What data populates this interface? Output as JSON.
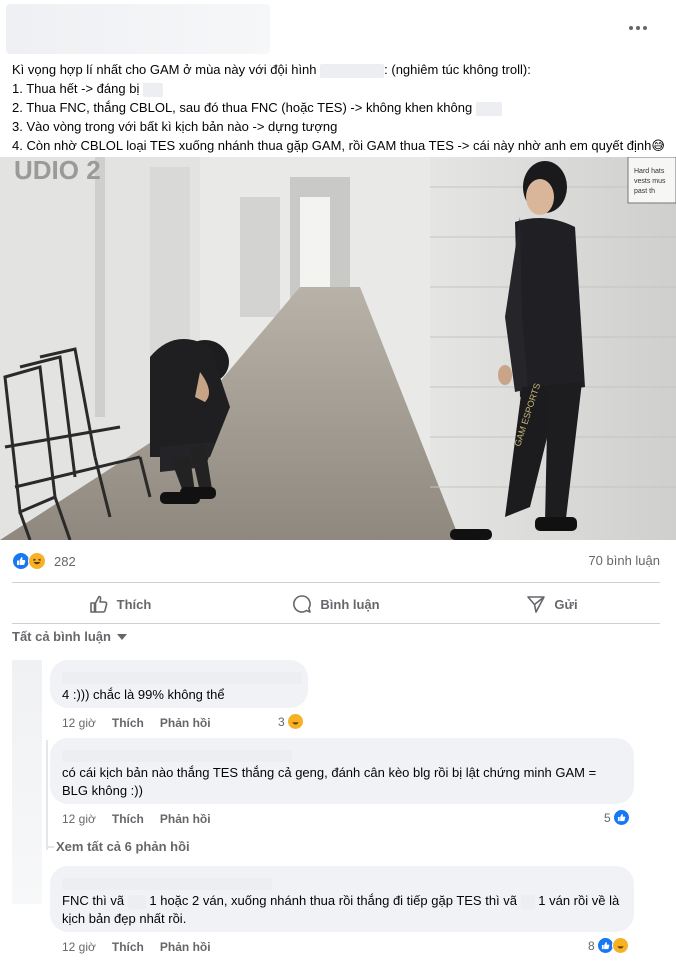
{
  "post": {
    "lines": [
      "Kì vọng hợp lí nhất cho GAM ở mùa này với đội hình",
      ": (nghiêm túc không troll):",
      "1. Thua hết -> đáng bị",
      "2. Thua FNC, thắng CBLOL, sau đó thua FNC (hoặc TES) -> không khen không",
      "3. Vào vòng trong với bất kì kịch bản nào -> dựng tượng",
      "4. Còn nhờ CBLOL loại TES xuống nhánh thua gặp GAM, rồi GAM thua TES -> cái này nhờ anh em quyết định😅"
    ]
  },
  "stats": {
    "reaction_count": "282",
    "comment_count": "70 bình luận"
  },
  "actions": {
    "like": "Thích",
    "comment": "Bình luận",
    "share": "Gửi"
  },
  "sort_label": "Tất cả bình luận",
  "comments": [
    {
      "text": "4 :))) chắc là 99% không thể",
      "time": "12 giờ",
      "like": "Thích",
      "reply": "Phản hồi",
      "reactions": "3"
    },
    {
      "text": "có cái kịch bản nào thắng TES thắng cả geng, đánh cân kèo blg rồi bị lật chứng minh GAM = BLG không :))",
      "time": "12 giờ",
      "like": "Thích",
      "reply": "Phản hồi",
      "reactions": "5"
    },
    {
      "text_a": "FNC thì vã",
      "text_b": "1 hoặc 2 ván, xuống nhánh thua rồi thắng đi tiếp gặp TES thì vã",
      "text_c": "1 ván rồi về là",
      "text_d": "kịch bản đẹp nhất rồi.",
      "time": "12 giờ",
      "like": "Thích",
      "reply": "Phản hồi",
      "reactions": "8"
    }
  ],
  "view_replies": "Xem tất cả 6 phản hồi",
  "colors": {
    "accent": "#1877f2",
    "haha": "#f7b125",
    "secondary_text": "#65676b",
    "bubble": "#f0f2f5"
  },
  "icons": [
    "more-horizontal-icon",
    "like-reaction-icon",
    "haha-reaction-icon",
    "thumbs-up-icon",
    "comment-icon",
    "share-icon",
    "caret-down-icon"
  ]
}
